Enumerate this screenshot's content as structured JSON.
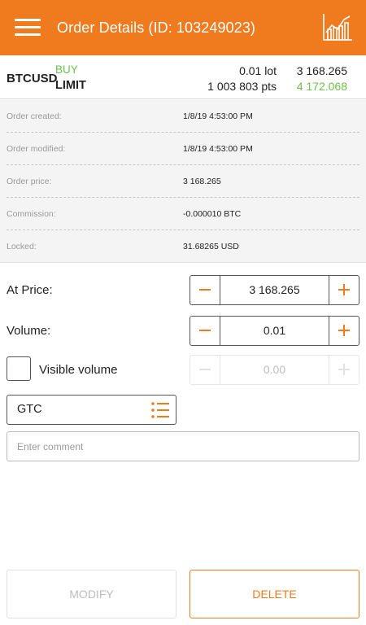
{
  "header": {
    "title": "Order Details (ID: 103249023)",
    "menu_icon": "hamburger-menu-icon",
    "chart_icon": "line-chart-icon"
  },
  "summary": {
    "symbol": "BTCUSD",
    "side": "BUY",
    "order_type": "LIMIT",
    "lot": "0.01 lot",
    "points": "1 003 803 pts",
    "price_top": "3 168.265",
    "price_bottom": "4 172.068"
  },
  "details": [
    {
      "label": "Order created:",
      "value": "1/8/19 4:53:00 PM"
    },
    {
      "label": "Order modified:",
      "value": "1/8/19 4:53:00 PM"
    },
    {
      "label": "Order price:",
      "value": "3 168.265"
    },
    {
      "label": "Commission:",
      "value": "-0.000010 BTC"
    },
    {
      "label": "Locked:",
      "value": "31.68265 USD"
    }
  ],
  "form": {
    "at_price_label": "At Price:",
    "at_price_value": "3 168.265",
    "volume_label": "Volume:",
    "volume_value": "0.01",
    "visible_volume_label": "Visible volume",
    "visible_volume_checked": false,
    "visible_volume_value": "0.00",
    "expiration_value": "GTC",
    "comment_placeholder": "Enter comment"
  },
  "buttons": {
    "modify": "MODIFY",
    "delete": "DELETE"
  },
  "colors": {
    "accent": "#f07a1e",
    "buy_green": "#6cc24a",
    "disabled": "#bdbdbd"
  }
}
